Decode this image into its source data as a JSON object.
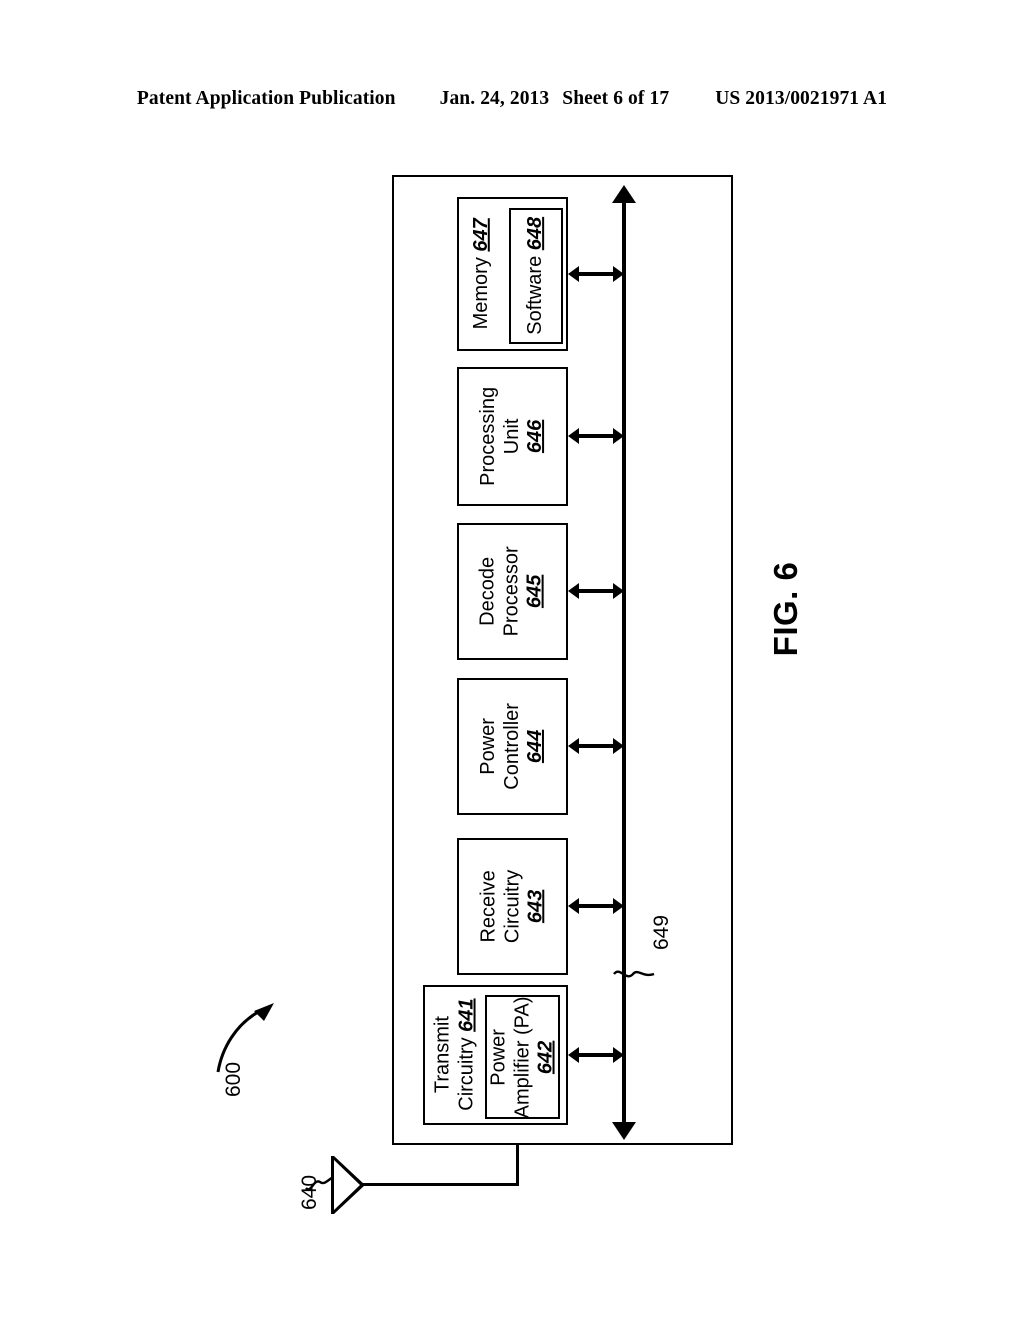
{
  "header": {
    "publication": "Patent Application Publication",
    "date": "Jan. 24, 2013",
    "sheet": "Sheet 6 of 17",
    "patent_number": "US 2013/0021971 A1"
  },
  "figure": {
    "caption": "FIG. 6",
    "device_ref": "600",
    "antenna_ref": "640",
    "bus_ref": "649"
  },
  "blocks": {
    "memory": {
      "label": "Memory",
      "ref": "647"
    },
    "software": {
      "label": "Software",
      "ref": "648"
    },
    "processing_unit": {
      "line1": "Processing",
      "line2": "Unit",
      "ref": "646"
    },
    "decode_processor": {
      "line1": "Decode",
      "line2": "Processor",
      "ref": "645"
    },
    "power_controller": {
      "line1": "Power",
      "line2": "Controller",
      "ref": "644"
    },
    "receive_circuitry": {
      "line1": "Receive",
      "line2": "Circuitry",
      "ref": "643"
    },
    "transmit_circuitry": {
      "line1": "Transmit",
      "line2": "Circuitry",
      "ref": "641"
    },
    "power_amplifier": {
      "line1": "Power",
      "line2": "Amplifier (PA)",
      "ref": "642"
    }
  }
}
